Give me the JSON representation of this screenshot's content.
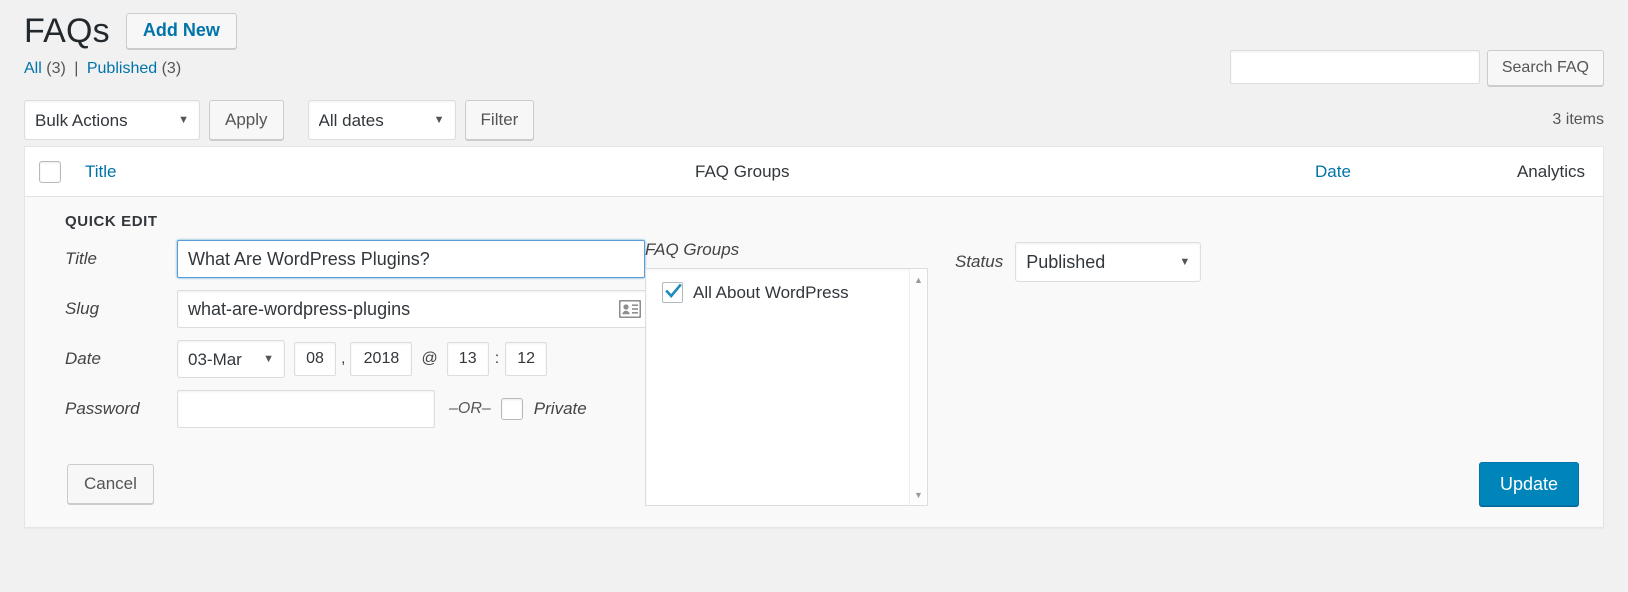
{
  "header": {
    "title": "FAQs",
    "add_new_label": "Add New"
  },
  "views": {
    "all_label": "All",
    "all_count": "(3)",
    "separator": "|",
    "published_label": "Published",
    "published_count": "(3)"
  },
  "search": {
    "value": "",
    "placeholder": "",
    "button_label": "Search FAQ"
  },
  "tablenav": {
    "bulk_actions_value": "Bulk Actions",
    "apply_label": "Apply",
    "all_dates_value": "All dates",
    "filter_label": "Filter",
    "displaying_num": "3 items"
  },
  "table": {
    "columns": [
      {
        "label": "Title",
        "link": true
      },
      {
        "label": "FAQ Groups",
        "link": false
      },
      {
        "label": "Date",
        "link": true
      },
      {
        "label": "Analytics",
        "link": false
      }
    ]
  },
  "quick_edit": {
    "legend": "QUICK EDIT",
    "title_label": "Title",
    "title_value": "What Are WordPress Plugins?",
    "slug_label": "Slug",
    "slug_value": "what-are-wordpress-plugins",
    "date_label": "Date",
    "date_month": "03-Mar",
    "date_day": "08",
    "date_comma": ",",
    "date_year": "2018",
    "date_at": "@",
    "date_hour": "13",
    "date_colon": ":",
    "date_minute": "12",
    "password_label": "Password",
    "password_value": "",
    "or_text": "–OR–",
    "private_label": "Private",
    "groups_label": "FAQ Groups",
    "groups": [
      {
        "label": "All About WordPress",
        "checked": true
      }
    ],
    "status_label": "Status",
    "status_value": "Published",
    "cancel_label": "Cancel",
    "update_label": "Update"
  },
  "colors": {
    "accent_blue": "#0073aa",
    "button_blue": "#0085ba",
    "page_bg": "#f1f1f1",
    "quick_edit_bg": "#f9f9f9",
    "focus_border": "#5b9dd9"
  }
}
